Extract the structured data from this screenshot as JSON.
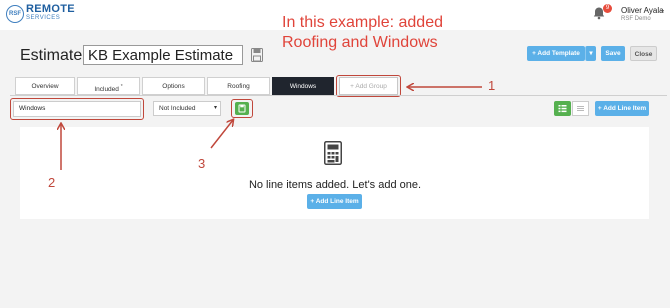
{
  "header": {
    "logo_title": "REMOTE",
    "logo_sub": "SERVICES",
    "logo_mark": "RSF",
    "notification_count": "9",
    "user_name": "Oliver Ayala",
    "user_company": "RSF Demo"
  },
  "annotation": {
    "note": "In this example: added Roofing and Windows",
    "markers": [
      "1",
      "2",
      "3"
    ],
    "color": "#c0473b"
  },
  "estimate": {
    "label": "Estimate:",
    "name": "KB Example Estimate"
  },
  "toolbar": {
    "add_template_label": "+ Add Template",
    "save_label": "Save",
    "close_label": "Close"
  },
  "tabs": [
    {
      "label": "Overview"
    },
    {
      "label": "Included",
      "sup": "*"
    },
    {
      "label": "Options"
    },
    {
      "label": "Roofing"
    },
    {
      "label": "Windows",
      "active": true
    },
    {
      "label": "+ Add Group"
    }
  ],
  "group": {
    "name_value": "Windows",
    "inclusion_selected": "Not Included"
  },
  "view": {
    "add_line_item_label": "+ Add Line Item"
  },
  "empty_state": {
    "message": "No line items added. Let's add one.",
    "button_label": "+ Add Line Item"
  },
  "colors": {
    "accent_blue": "#5bb0e8",
    "active_tab": "#20252e",
    "green": "#55b04f",
    "annotation_red": "#e0443a"
  }
}
